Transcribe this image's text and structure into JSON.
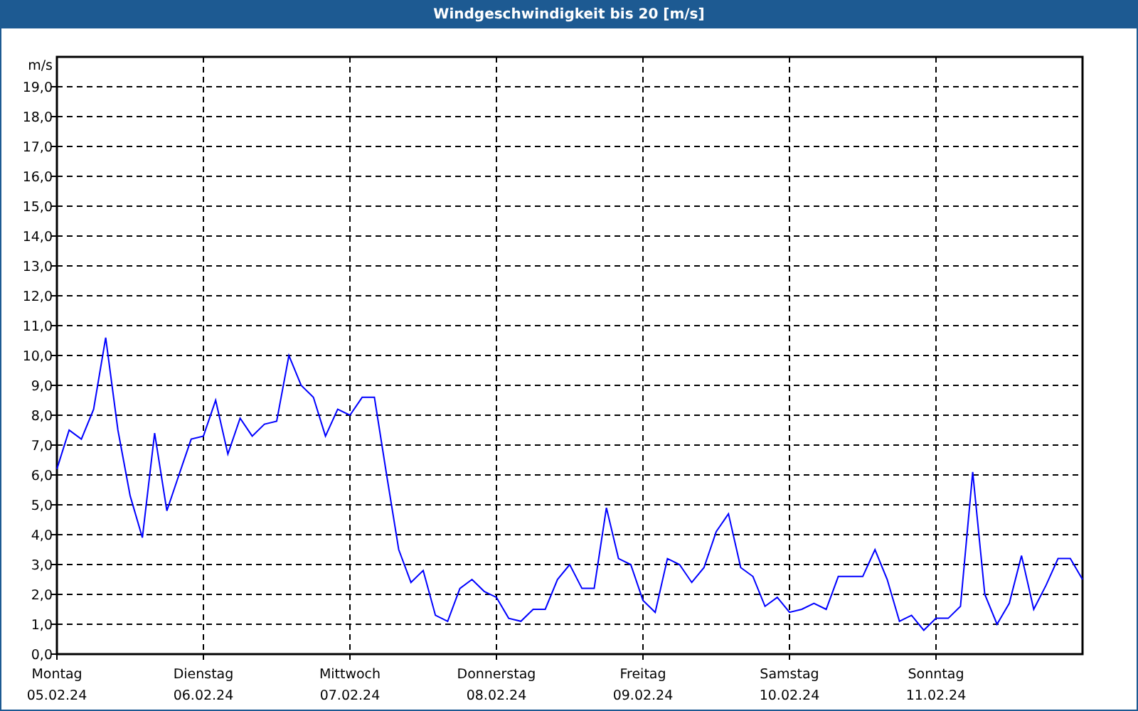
{
  "window": {
    "title": "Windgeschwindigkeit bis 20 [m/s]"
  },
  "chart": {
    "x_dates": [
      "05.02.24",
      "06.02.24",
      "07.02.24",
      "08.02.24",
      "09.02.24",
      "10.02.24",
      "11.02.24"
    ],
    "chart_data": {
      "type": "line",
      "grid": true,
      "ylabel": "m/s",
      "ylim": [
        0,
        20
      ],
      "yticks": [
        {
          "value": 0,
          "label": "0,0"
        },
        {
          "value": 1,
          "label": "1,0"
        },
        {
          "value": 2,
          "label": "2,0"
        },
        {
          "value": 3,
          "label": "3,0"
        },
        {
          "value": 4,
          "label": "4,0"
        },
        {
          "value": 5,
          "label": "5,0"
        },
        {
          "value": 6,
          "label": "6,0"
        },
        {
          "value": 7,
          "label": "7,0"
        },
        {
          "value": 8,
          "label": "8,0"
        },
        {
          "value": 9,
          "label": "9,0"
        },
        {
          "value": 10,
          "label": "10,0"
        },
        {
          "value": 11,
          "label": "11,0"
        },
        {
          "value": 12,
          "label": "12,0"
        },
        {
          "value": 13,
          "label": "13,0"
        },
        {
          "value": 14,
          "label": "14,0"
        },
        {
          "value": 15,
          "label": "15,0"
        },
        {
          "value": 16,
          "label": "16,0"
        },
        {
          "value": 17,
          "label": "17,0"
        },
        {
          "value": 18,
          "label": "18,0"
        },
        {
          "value": 19,
          "label": "19,0"
        }
      ],
      "categories": [
        "Montag",
        null,
        null,
        null,
        null,
        null,
        null,
        null,
        null,
        null,
        null,
        null,
        "Dienstag",
        null,
        null,
        null,
        null,
        null,
        null,
        null,
        null,
        null,
        null,
        null,
        "Mittwoch",
        null,
        null,
        null,
        null,
        null,
        null,
        null,
        null,
        null,
        null,
        null,
        "Donnerstag",
        null,
        null,
        null,
        null,
        null,
        null,
        null,
        null,
        null,
        null,
        null,
        "Freitag",
        null,
        null,
        null,
        null,
        null,
        null,
        null,
        null,
        null,
        null,
        null,
        "Samstag",
        null,
        null,
        null,
        null,
        null,
        null,
        null,
        null,
        null,
        null,
        null,
        "Sonntag",
        null,
        null,
        null,
        null,
        null,
        null,
        null,
        null,
        null,
        null,
        null,
        null
      ],
      "series": [
        {
          "color": "#0000ff",
          "values": [
            6.2,
            7.5,
            7.2,
            8.2,
            10.6,
            7.5,
            5.3,
            3.9,
            7.4,
            4.8,
            6.0,
            7.2,
            7.3,
            8.5,
            6.7,
            7.9,
            7.3,
            7.7,
            7.8,
            10.0,
            9.0,
            8.6,
            7.3,
            8.2,
            8.0,
            8.6,
            8.6,
            6.0,
            3.5,
            2.4,
            2.8,
            1.3,
            1.1,
            2.2,
            2.5,
            2.1,
            1.9,
            1.2,
            1.1,
            1.5,
            1.5,
            2.5,
            3.0,
            2.2,
            2.2,
            4.9,
            3.2,
            3.0,
            1.8,
            1.4,
            3.2,
            3.0,
            2.4,
            2.9,
            4.1,
            4.7,
            2.9,
            2.6,
            1.6,
            1.9,
            1.4,
            1.5,
            1.7,
            1.5,
            2.6,
            2.6,
            2.6,
            3.5,
            2.5,
            1.1,
            1.3,
            0.8,
            1.2,
            1.2,
            1.6,
            6.1,
            2.0,
            1.0,
            1.7,
            3.3,
            1.5,
            2.3,
            3.2,
            3.2,
            2.5
          ]
        }
      ]
    }
  }
}
